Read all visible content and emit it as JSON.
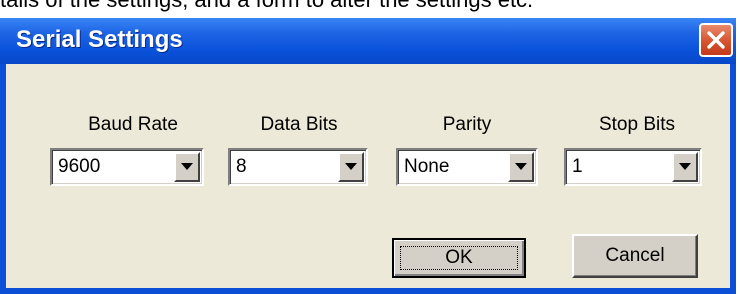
{
  "window": {
    "title": "Serial Settings",
    "top_fragment": "tails of the settings, and a form to alter the settings etc."
  },
  "fields": [
    {
      "label": "Baud Rate",
      "value": "9600"
    },
    {
      "label": "Data Bits",
      "value": "8"
    },
    {
      "label": "Parity",
      "value": "None"
    },
    {
      "label": "Stop Bits",
      "value": "1"
    }
  ],
  "buttons": {
    "ok_label": "OK",
    "cancel_label": "Cancel"
  },
  "icons": {
    "close": "close-icon",
    "dropdown": "chevron-down-icon"
  },
  "colors": {
    "titlebar": "#0a52da",
    "client": "#ece9d8",
    "close": "#d6532f"
  }
}
